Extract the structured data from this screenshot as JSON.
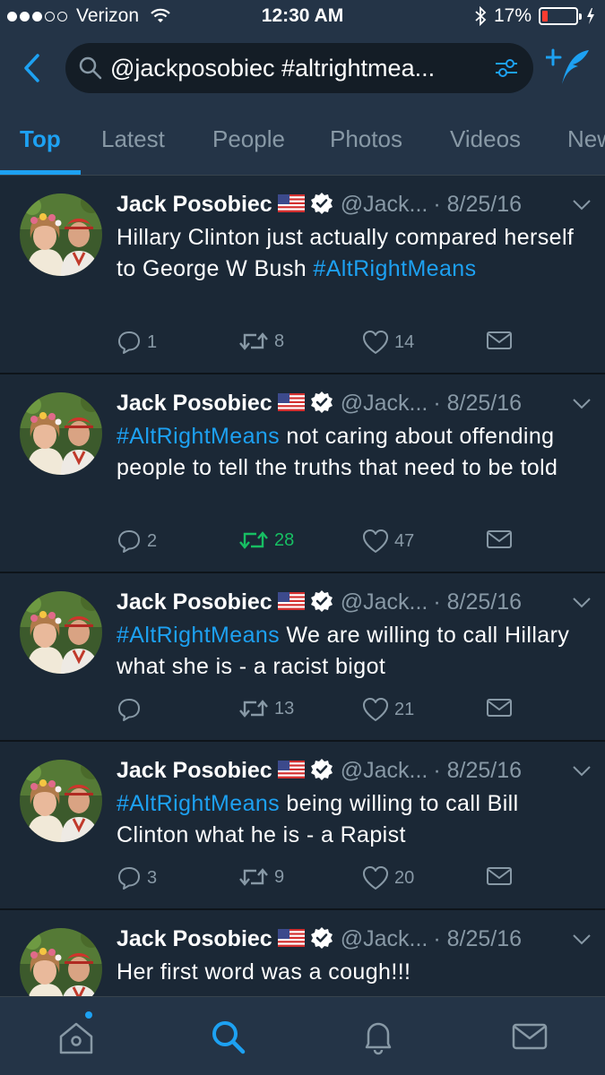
{
  "status_bar": {
    "carrier": "Verizon",
    "time": "12:30 AM",
    "battery_percent": "17%",
    "battery_level": 0.17,
    "battery_color": "#ff3b30"
  },
  "search": {
    "query": "@jackposobiec #altrightmea..."
  },
  "tabs": [
    "Top",
    "Latest",
    "People",
    "Photos",
    "Videos",
    "News"
  ],
  "active_tab": "Top",
  "colors": {
    "accent": "#1da1f2",
    "retweet_active": "#17bf63",
    "background": "#141d26",
    "header": "#243447",
    "muted": "#8899a6"
  },
  "tweets": [
    {
      "name": "Jack Posobiec",
      "handle": "@Jack...",
      "date": "· 8/25/16",
      "text_before": "Hillary Clinton just actually compared herself to George W Bush ",
      "hashtag": "#AltRightMeans",
      "text_after": "",
      "replies": "1",
      "retweets": "8",
      "likes": "14",
      "retweeted": false
    },
    {
      "name": "Jack Posobiec",
      "handle": "@Jack...",
      "date": "· 8/25/16",
      "text_before": "",
      "hashtag": "#AltRightMeans",
      "text_after": " not caring about offending people to tell the truths that need to be told",
      "replies": "2",
      "retweets": "28",
      "likes": "47",
      "retweeted": true
    },
    {
      "name": "Jack Posobiec",
      "handle": "@Jack...",
      "date": "· 8/25/16",
      "text_before": "",
      "hashtag": "#AltRightMeans",
      "text_after": " We are willing to call Hillary what she is - a racist bigot",
      "replies": "",
      "retweets": "13",
      "likes": "21",
      "retweeted": false
    },
    {
      "name": "Jack Posobiec",
      "handle": "@Jack...",
      "date": "· 8/25/16",
      "text_before": "",
      "hashtag": "#AltRightMeans",
      "text_after": " being willing to call Bill Clinton what he is - a Rapist",
      "replies": "3",
      "retweets": "9",
      "likes": "20",
      "retweeted": false
    },
    {
      "name": "Jack Posobiec",
      "handle": "@Jack...",
      "date": "· 8/25/16",
      "text_before": "Her first word was a cough!!!",
      "hashtag": "",
      "text_after": ""
    }
  ],
  "bottom_nav": [
    "home-icon",
    "search-icon",
    "notifications-icon",
    "messages-icon"
  ]
}
